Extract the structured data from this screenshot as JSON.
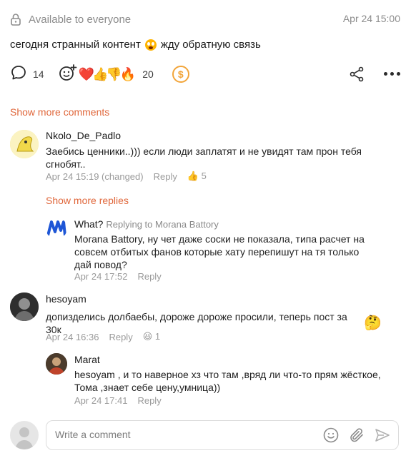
{
  "post": {
    "visibility": "Available to everyone",
    "date": "Apr 24 15:00",
    "text_before": "сегодня странный контент",
    "text_after": "жду обратную связь",
    "comments_count": "14",
    "reactions_count": "20",
    "reaction_emojis": "❤️👍👎🔥"
  },
  "show_more_comments": "Show more comments",
  "comments": [
    {
      "author": "Nkolo_De_Padlo",
      "text": "Заебись ценники..))) если люди заплатят и не увидят там прон тебя сгнобят..",
      "time": "Apr 24 15:19 (changed)",
      "reply_label": "Reply",
      "reaction_emoji": "👍",
      "reaction_count": "5",
      "show_more_replies": "Show more replies",
      "replies": [
        {
          "author": "What?",
          "replying_to": "Replying to Morana Battory",
          "text": "Morana Battory, ну чет даже соски не показала, типа расчет на совсем отбитых фанов которые хату перепишут на тя только дай повод?",
          "time": "Apr 24 17:52",
          "reply_label": "Reply"
        }
      ]
    },
    {
      "author": "hesoyam",
      "text": "допизделись долбаебы, дороже дороже просили, теперь пост за 30к",
      "text_emoji": "🤔",
      "time": "Apr 24 16:36",
      "reply_label": "Reply",
      "reaction_emoji": "😆",
      "reaction_count": "1",
      "replies": [
        {
          "author": "Marat",
          "text": "hesoyam , и то наверное хз что там ,вряд ли что-то прям жёсткое, Тома ,знает себе цену,умница))",
          "time": "Apr 24 17:41",
          "reply_label": "Reply"
        }
      ]
    }
  ],
  "composer": {
    "placeholder": "Write a comment"
  },
  "colors": {
    "accent": "#e0673b",
    "coin": "#f2a53a",
    "muted": "#8a8a8a"
  },
  "icons": [
    "lock-icon",
    "comment-icon",
    "add-reaction-icon",
    "coin-icon",
    "share-icon",
    "more-icon",
    "emoji-icon",
    "attach-icon",
    "send-icon"
  ]
}
